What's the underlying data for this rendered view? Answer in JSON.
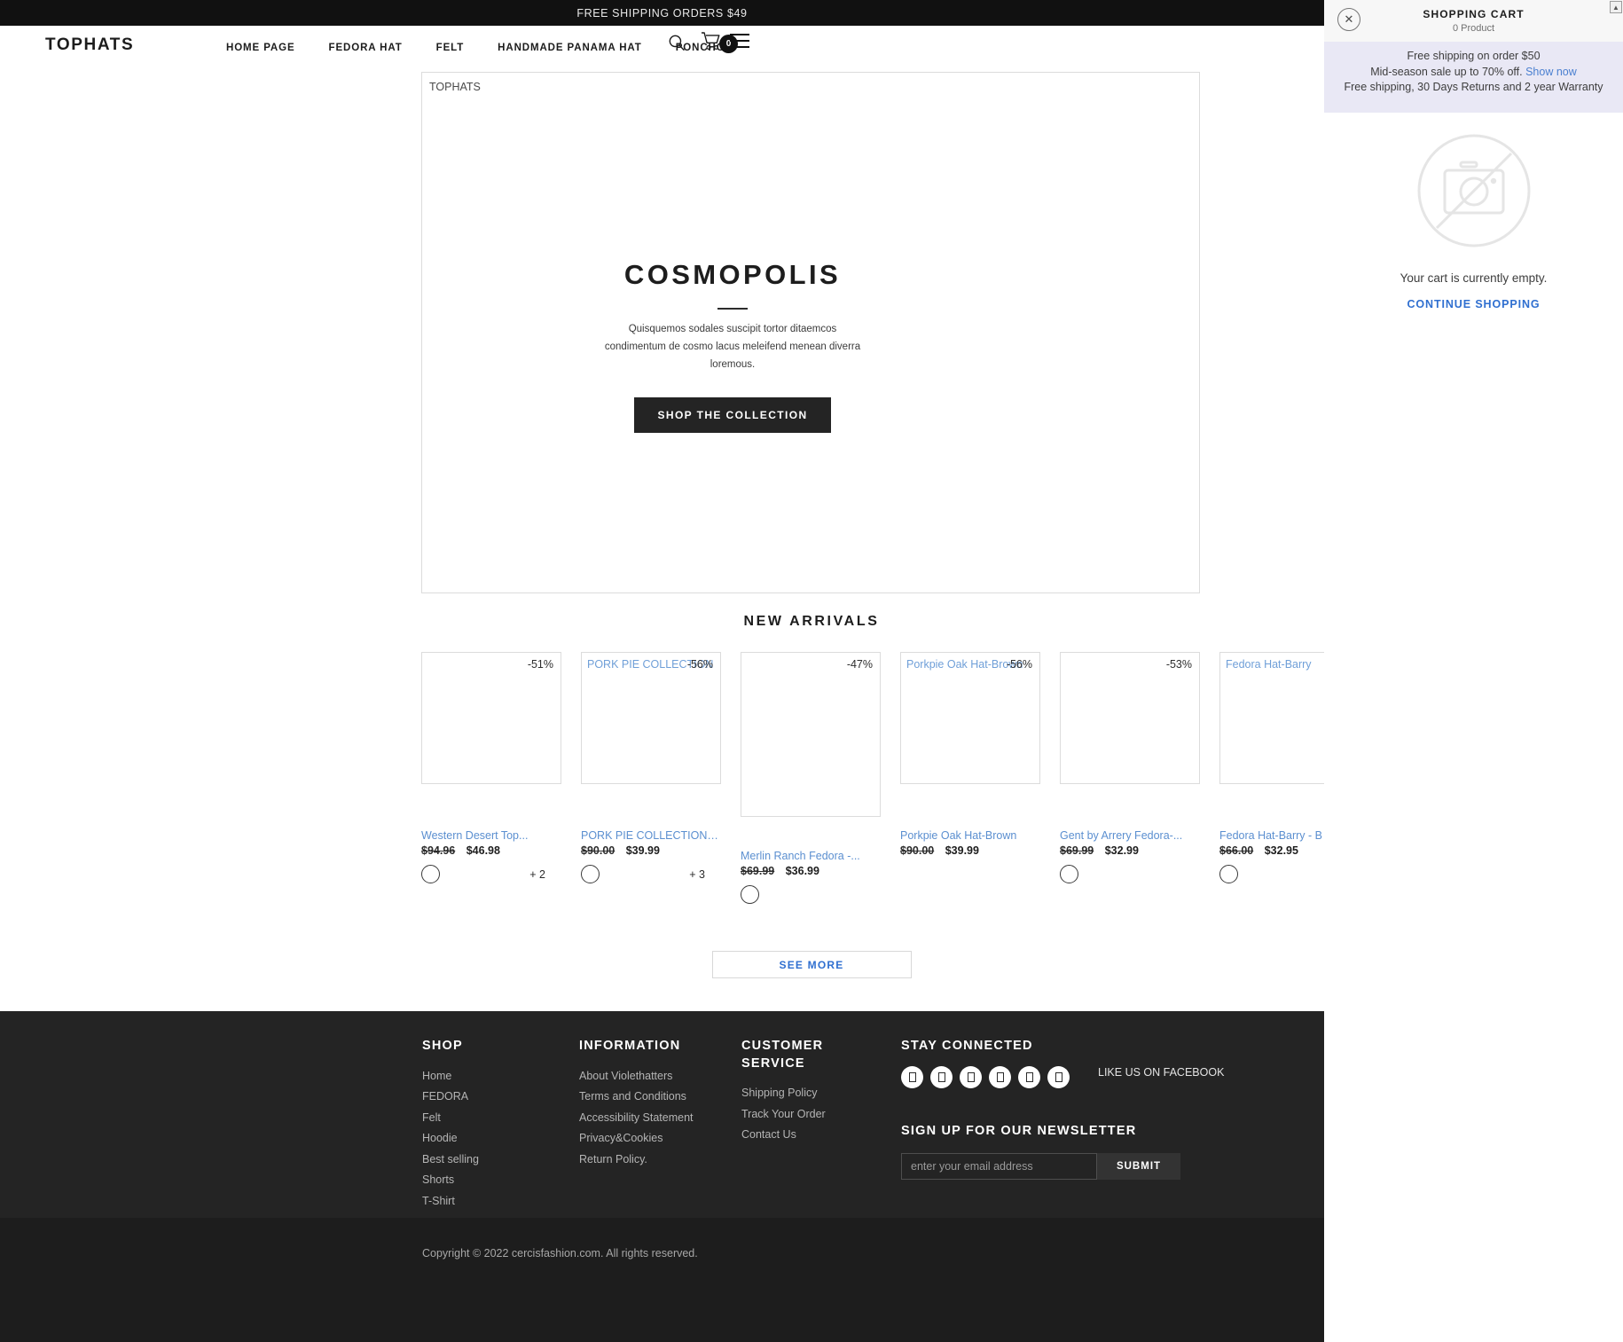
{
  "announcement": {
    "text": "FREE SHIPPING ORDERS $49"
  },
  "header": {
    "brand": "TOPHATS",
    "nav": [
      {
        "label": "HOME PAGE"
      },
      {
        "label": "FEDORA HAT"
      },
      {
        "label": "FELT"
      },
      {
        "label": "HANDMADE PANAMA HAT"
      },
      {
        "label": "PONCHO"
      }
    ],
    "search_icon": "search-icon",
    "cart_icon": "cart-icon",
    "cart_count": "0",
    "menu_icon": "hamburger-menu-icon"
  },
  "hero": {
    "alt_text": "TOPHATS",
    "title": "COSMOPOLIS",
    "subtitle": "Quisquemos sodales suscipit tortor ditaemcos condimentum de cosmo lacus meleifend menean diverra loremous.",
    "button": "SHOP THE COLLECTION"
  },
  "arrivals": {
    "title": "NEW ARRIVALS",
    "see_more": "SEE MORE",
    "products": [
      {
        "alt_text": "",
        "discount": "-51%",
        "name": "Western Desert Top...",
        "old_price": "$94.96",
        "new_price": "$46.98",
        "extra_swatches": "+ 2"
      },
      {
        "alt_text": "PORK PIE COLLECTION",
        "discount": "-56%",
        "name": "PORK PIE COLLECTION -...",
        "old_price": "$90.00",
        "new_price": "$39.99",
        "extra_swatches": "+ 3"
      },
      {
        "alt_text": "",
        "discount": "-47%",
        "name": "Merlin Ranch Fedora -...",
        "old_price": "$69.99",
        "new_price": "$36.99",
        "extra_swatches": ""
      },
      {
        "alt_text": "Porkpie Oak Hat-Brown",
        "discount": "-56%",
        "name": "Porkpie Oak Hat-Brown",
        "old_price": "$90.00",
        "new_price": "$39.99",
        "extra_swatches": ""
      },
      {
        "alt_text": "",
        "discount": "-53%",
        "name": "Gent by Arrery Fedora-...",
        "old_price": "$69.99",
        "new_price": "$32.99",
        "extra_swatches": ""
      },
      {
        "alt_text": "Fedora Hat-Barry",
        "discount": "",
        "name": "Fedora Hat-Barry - B",
        "old_price": "$66.00",
        "new_price": "$32.95",
        "extra_swatches": ""
      }
    ]
  },
  "footer": {
    "shop": {
      "title": "SHOP",
      "links": [
        {
          "label": "Home"
        },
        {
          "label": "FEDORA"
        },
        {
          "label": "Felt"
        },
        {
          "label": "Hoodie"
        },
        {
          "label": "Best selling"
        },
        {
          "label": "Shorts"
        },
        {
          "label": "T-Shirt"
        }
      ]
    },
    "information": {
      "title": "INFORMATION",
      "links": [
        {
          "label": "About Violethatters"
        },
        {
          "label": "Terms and Conditions"
        },
        {
          "label": "Accessibility Statement"
        },
        {
          "label": "Privacy&Cookies"
        },
        {
          "label": "Return Policy."
        }
      ]
    },
    "customer_service": {
      "title": "CUSTOMER SERVICE",
      "links": [
        {
          "label": "Shipping Policy"
        },
        {
          "label": "Track Your Order"
        },
        {
          "label": "Contact Us"
        }
      ]
    },
    "stay_connected": {
      "title": "STAY CONNECTED",
      "facebook_text": "LIKE US ON FACEBOOK",
      "icons": [
        "facebook-icon",
        "twitter-icon",
        "instagram-icon",
        "pinterest-icon",
        "youtube-icon",
        "tumblr-icon"
      ]
    },
    "newsletter": {
      "title": "SIGN UP FOR OUR NEWSLETTER",
      "placeholder": "enter your email address",
      "value": "",
      "submit": "SUBMIT"
    },
    "copyright": "Copyright © 2022 cercisfashion.com. All rights reserved."
  },
  "cart_drawer": {
    "title": "SHOPPING CART",
    "count": "0 Product",
    "close_icon": "close-icon",
    "promo_line1": "Free shipping on order $50",
    "promo_line2_text": "Mid-season sale up to 70% off.",
    "promo_link": "Show now",
    "promo_line3": "Free shipping, 30 Days Returns and 2 year Warranty",
    "empty_text": "Your cart is currently empty.",
    "continue_label": "CONTINUE SHOPPING",
    "empty_icon": "no-image-icon"
  },
  "colors": {
    "accent_link": "#2f6fd0",
    "product_link": "#5b8fd0",
    "dark": "#242424",
    "promo_bg": "#e9e8f5"
  }
}
